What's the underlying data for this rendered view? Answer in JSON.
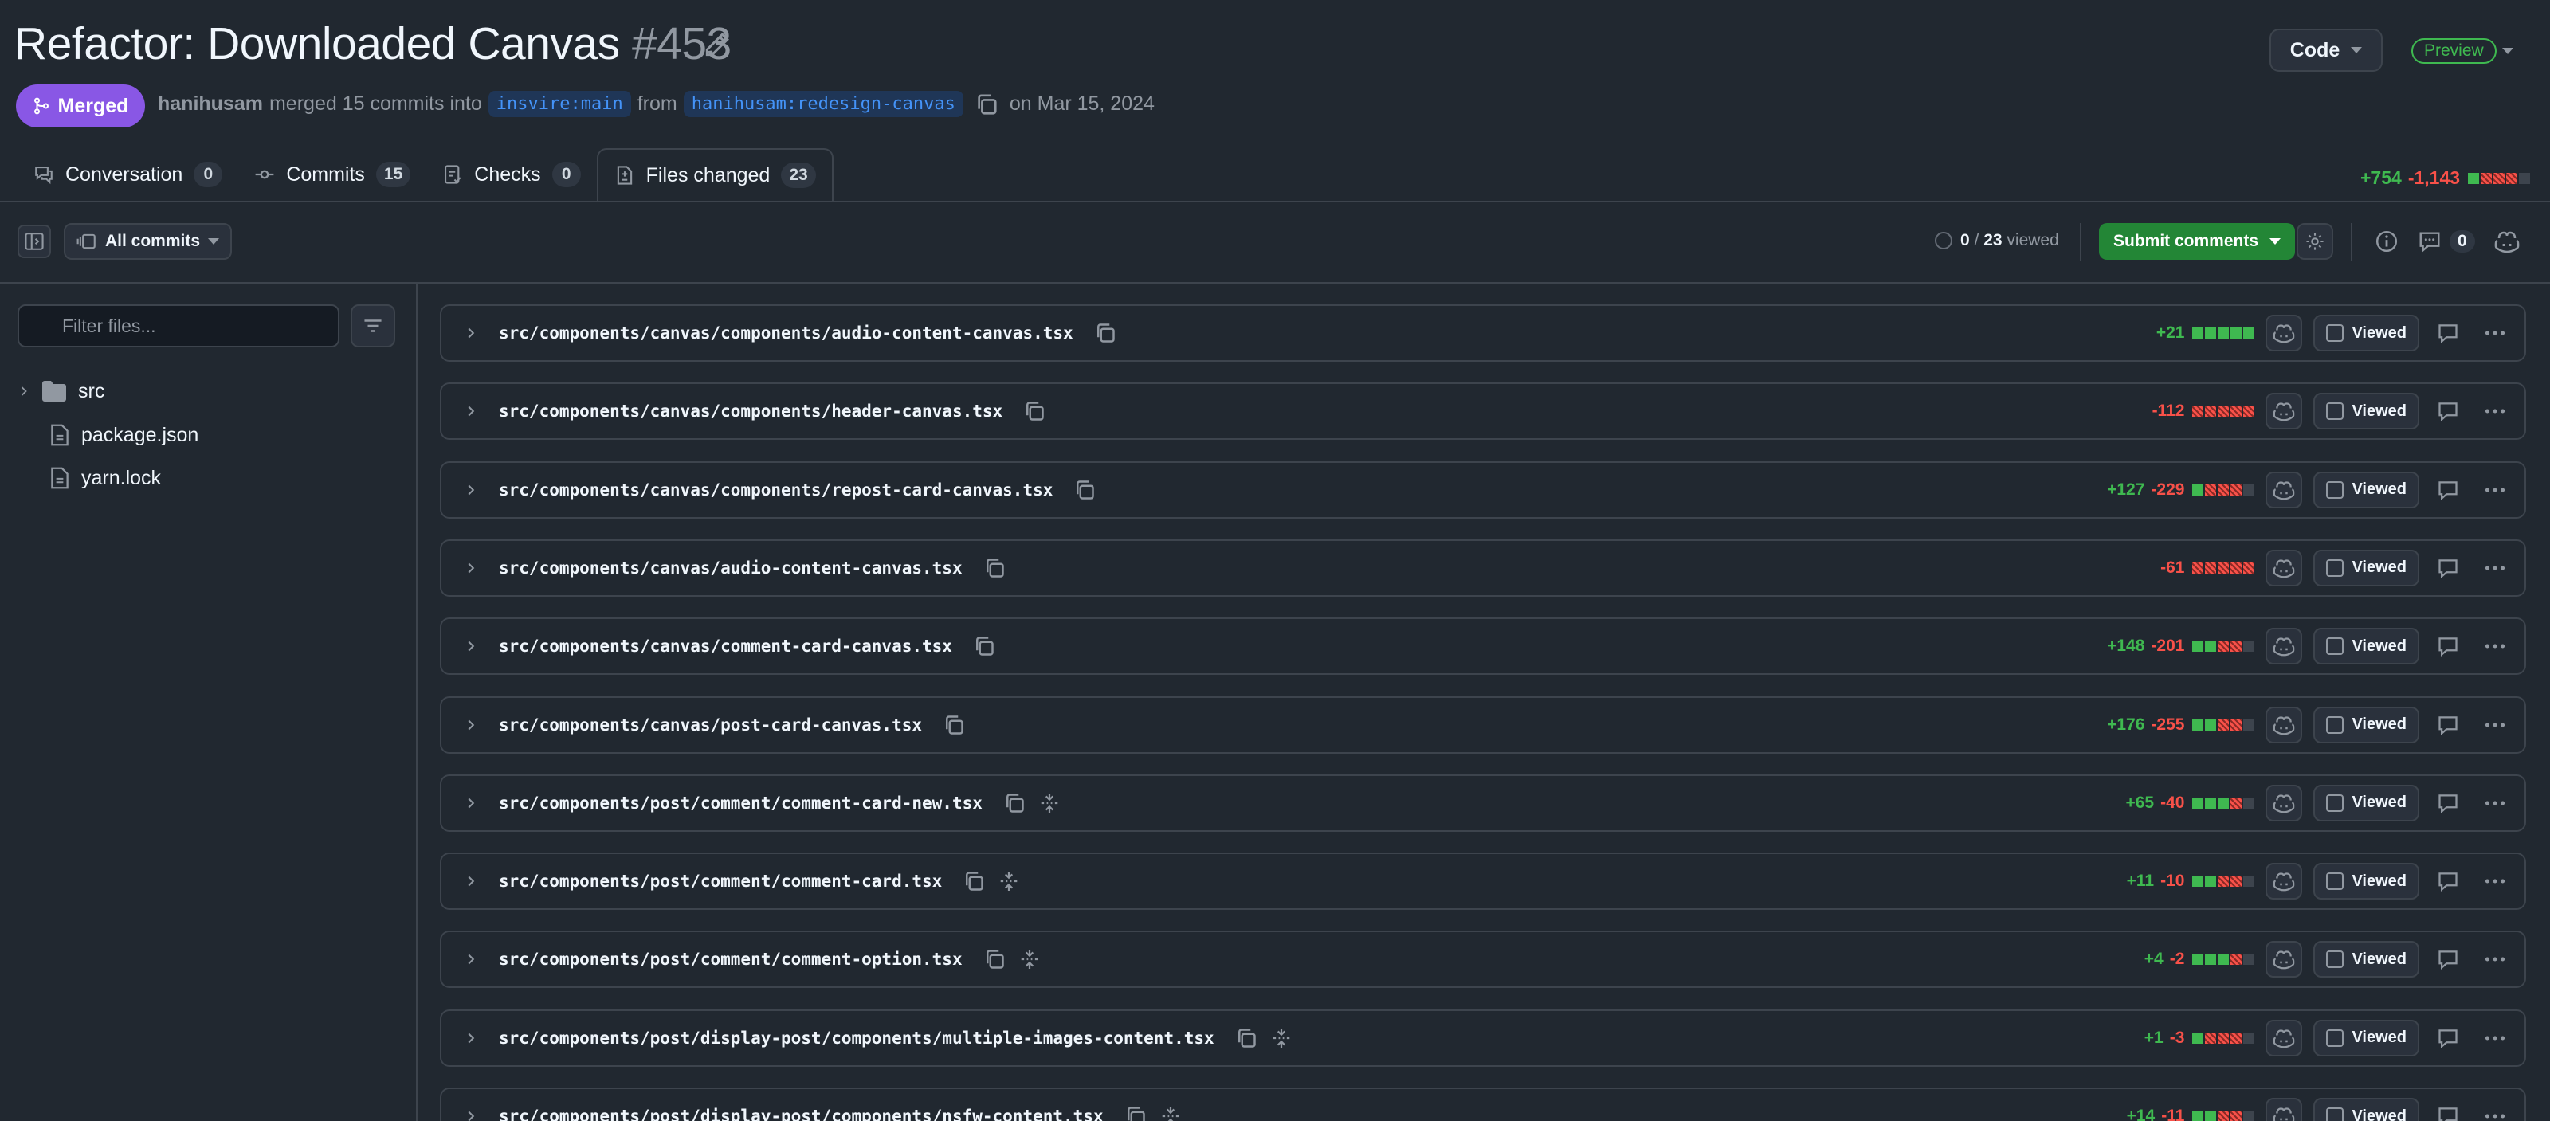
{
  "header": {
    "title": "Refactor: Downloaded Canvas",
    "number": "#453",
    "code_button": "Code",
    "preview_badge": "Preview"
  },
  "meta": {
    "state": "Merged",
    "author": "hanihusam",
    "action": "merged 15 commits into",
    "base_branch": "insvire:main",
    "from_word": "from",
    "head_branch": "hanihusam:redesign-canvas",
    "date": "on Mar 15, 2024"
  },
  "tabs": [
    {
      "label": "Conversation",
      "count": "0",
      "icon": "conversation-icon"
    },
    {
      "label": "Commits",
      "count": "15",
      "icon": "commit-icon"
    },
    {
      "label": "Checks",
      "count": "0",
      "icon": "checks-icon"
    },
    {
      "label": "Files changed",
      "count": "23",
      "icon": "file-diff-icon"
    }
  ],
  "diffstat_total": {
    "additions": "+754",
    "deletions": "-1,143",
    "squares": "grrrn"
  },
  "toolbar": {
    "all_commits": "All commits",
    "viewed_done": "0",
    "viewed_sep": "/",
    "viewed_total": "23",
    "viewed_label": "viewed",
    "submit": "Submit comments",
    "comments_count": "0"
  },
  "sidebar": {
    "filter_placeholder": "Filter files...",
    "tree": [
      {
        "label": "src",
        "type": "folder"
      },
      {
        "label": "package.json",
        "type": "file"
      },
      {
        "label": "yarn.lock",
        "type": "file"
      }
    ]
  },
  "viewed_label": "Viewed",
  "files": [
    {
      "path": "src/components/canvas/components/audio-content-canvas.tsx",
      "add": "+21",
      "del": "",
      "squares": "ggggg",
      "expand": false
    },
    {
      "path": "src/components/canvas/components/header-canvas.tsx",
      "add": "",
      "del": "-112",
      "squares": "rrrrr",
      "expand": false
    },
    {
      "path": "src/components/canvas/components/repost-card-canvas.tsx",
      "add": "+127",
      "del": "-229",
      "squares": "grrrn",
      "expand": false
    },
    {
      "path": "src/components/canvas/audio-content-canvas.tsx",
      "add": "",
      "del": "-61",
      "squares": "rrrrr",
      "expand": false
    },
    {
      "path": "src/components/canvas/comment-card-canvas.tsx",
      "add": "+148",
      "del": "-201",
      "squares": "ggrrn",
      "expand": false
    },
    {
      "path": "src/components/canvas/post-card-canvas.tsx",
      "add": "+176",
      "del": "-255",
      "squares": "ggrrn",
      "expand": false
    },
    {
      "path": "src/components/post/comment/comment-card-new.tsx",
      "add": "+65",
      "del": "-40",
      "squares": "gggrn",
      "expand": true
    },
    {
      "path": "src/components/post/comment/comment-card.tsx",
      "add": "+11",
      "del": "-10",
      "squares": "ggrrn",
      "expand": true
    },
    {
      "path": "src/components/post/comment/comment-option.tsx",
      "add": "+4",
      "del": "-2",
      "squares": "gggrn",
      "expand": true
    },
    {
      "path": "src/components/post/display-post/components/multiple-images-content.tsx",
      "add": "+1",
      "del": "-3",
      "squares": "grrrn",
      "expand": true
    },
    {
      "path": "src/components/post/display-post/components/nsfw-content.tsx",
      "add": "+14",
      "del": "-11",
      "squares": "ggrrn",
      "expand": true
    }
  ]
}
